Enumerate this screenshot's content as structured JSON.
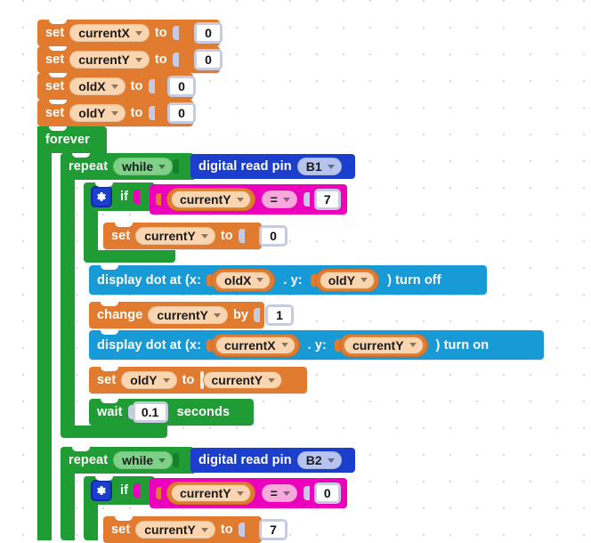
{
  "app": {
    "type": "block-based-visual-programming-editor",
    "canvas_background": "#ffffff",
    "grid_dot_color": "#d8d8d8"
  },
  "palette": {
    "variables_orange": "#e07b30",
    "variable_pill": "#fbd5b0",
    "control_green": "#1f9c33",
    "control_pill": "#7fd18a",
    "display_blue": "#189ad6",
    "pin_blue": "#1b3fcc",
    "pin_pill": "#b7c4ee",
    "operator_magenta": "#ec00bb",
    "operator_pill": "#f9a8de",
    "input_border": "#c6cbe2"
  },
  "script": {
    "init": [
      {
        "keyword": "set",
        "variable": "currentX",
        "to_label": "to",
        "value": "0"
      },
      {
        "keyword": "set",
        "variable": "currentY",
        "to_label": "to",
        "value": "0"
      },
      {
        "keyword": "set",
        "variable": "oldX",
        "to_label": "to",
        "value": "0"
      },
      {
        "keyword": "set",
        "variable": "oldY",
        "to_label": "to",
        "value": "0"
      }
    ],
    "forever": {
      "label": "forever"
    },
    "loop_b1": {
      "repeat_label": "repeat",
      "mode": "while",
      "condition": {
        "block": "digital read pin",
        "pin": "B1"
      },
      "if_block": {
        "label": "if",
        "gear_icon": "gear-icon",
        "operand_left": "currentY",
        "operator": "=",
        "operand_right": "7",
        "body": [
          {
            "keyword": "set",
            "variable": "currentY",
            "to_label": "to",
            "value": "0"
          }
        ]
      },
      "body": [
        {
          "block": "display-dot",
          "prefix": "display dot at  (x:",
          "x_var": "oldX",
          "mid": ". y:",
          "y_var": "oldY",
          "suffix": ") turn off"
        },
        {
          "keyword": "change",
          "variable": "currentY",
          "by_label": "by",
          "value": "1"
        },
        {
          "block": "display-dot",
          "prefix": "display dot at  (x:",
          "x_var": "currentX",
          "mid": ". y:",
          "y_var": "currentY",
          "suffix": ") turn on"
        },
        {
          "keyword": "set",
          "variable": "oldY",
          "to_label": "to",
          "value_var": "currentY"
        },
        {
          "keyword": "wait",
          "value": "0.1",
          "unit_label": "seconds"
        }
      ]
    },
    "loop_b2": {
      "repeat_label": "repeat",
      "mode": "while",
      "condition": {
        "block": "digital read pin",
        "pin": "B2"
      },
      "if_block": {
        "label": "if",
        "gear_icon": "gear-icon",
        "operand_left": "currentY",
        "operator": "=",
        "operand_right": "0",
        "body": [
          {
            "keyword": "set",
            "variable": "currentY",
            "to_label": "to",
            "value": "7"
          }
        ]
      }
    }
  }
}
